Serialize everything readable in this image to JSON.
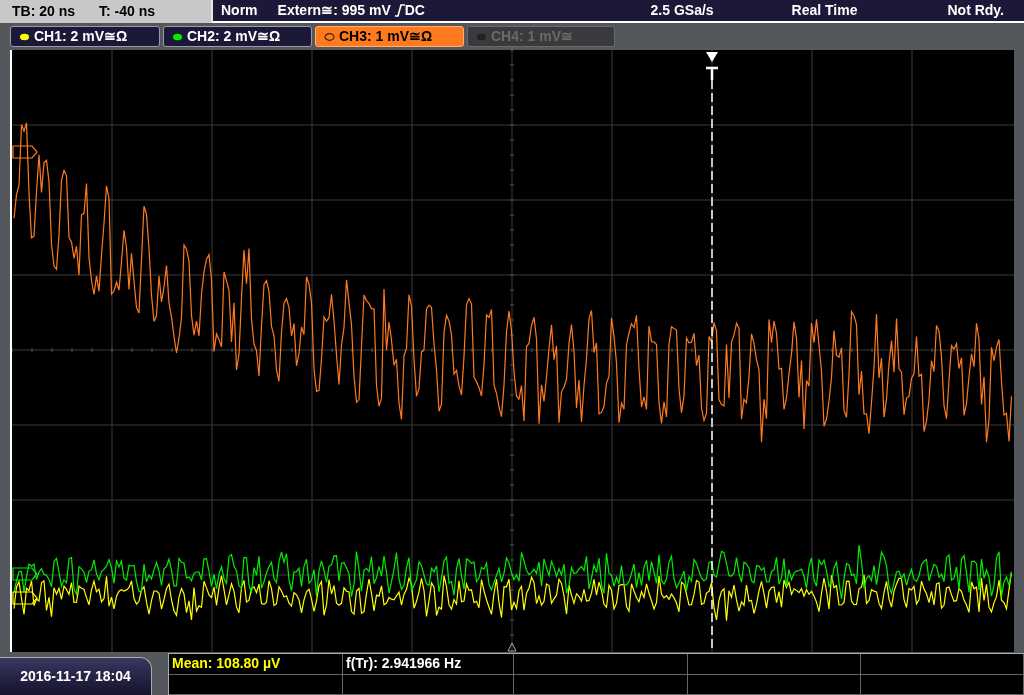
{
  "status_bar": {
    "timebase": "TB: 20 ns",
    "trigger_time": "T: -40 ns",
    "trigger_mode": "Norm",
    "trigger_source": "Extern≅: 995 mV",
    "trigger_coupling": "DC",
    "sample_rate": "2.5 GSa/s",
    "acquisition": "Real Time",
    "state": "Not Rdy."
  },
  "channels": [
    {
      "label": "CH1: 2 mV≅Ω",
      "color": "#ffff00",
      "selected": false,
      "enabled": true
    },
    {
      "label": "CH2: 2 mV≅Ω",
      "color": "#00ee00",
      "selected": false,
      "enabled": true
    },
    {
      "label": "CH3: 1 mV≅Ω",
      "color": "#ff7a1f",
      "selected": true,
      "enabled": true
    },
    {
      "label": "CH4: 1 mV≅",
      "color": "#6a6a6a",
      "selected": false,
      "enabled": false
    }
  ],
  "measurements": [
    {
      "label": "Mean: 108.80 µV",
      "color": "#ffff00"
    },
    {
      "label": "f(Tr): 2.941966 Hz",
      "color": "#ffffff"
    }
  ],
  "date_time": "2016-11-17 18:04"
}
